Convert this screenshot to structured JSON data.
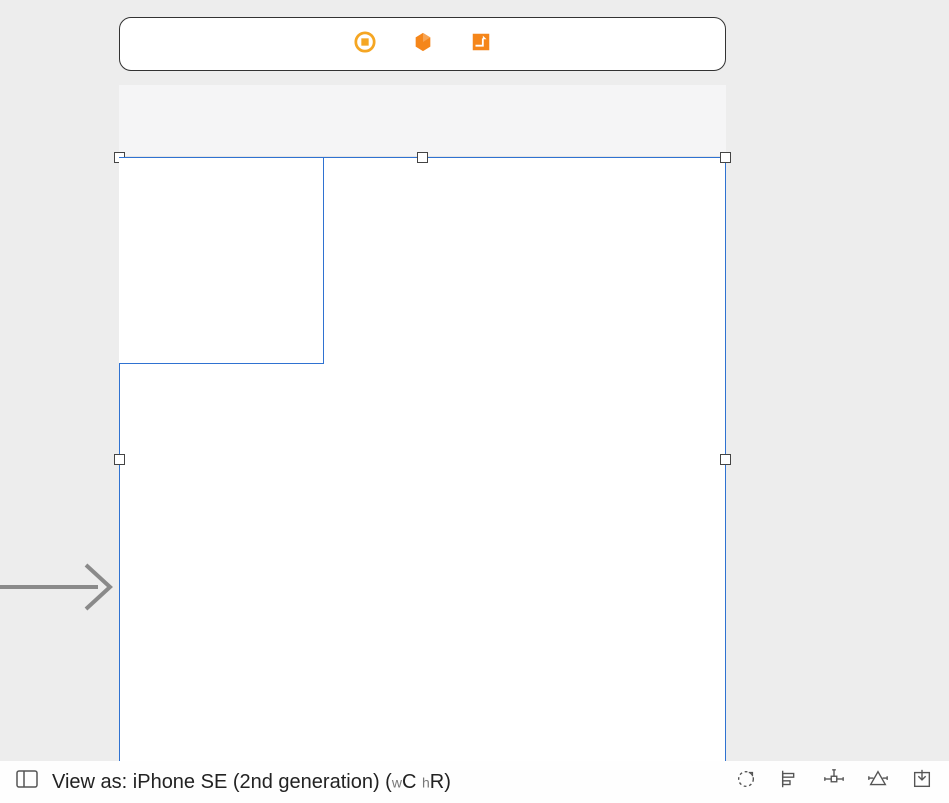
{
  "footer": {
    "view_as_prefix": "View as: ",
    "device": "iPhone SE (2nd generation)",
    "width_prefix": "w",
    "width_class": "C",
    "height_prefix": "h",
    "height_class": "R",
    "open_paren": " (",
    "close_paren": ")"
  }
}
